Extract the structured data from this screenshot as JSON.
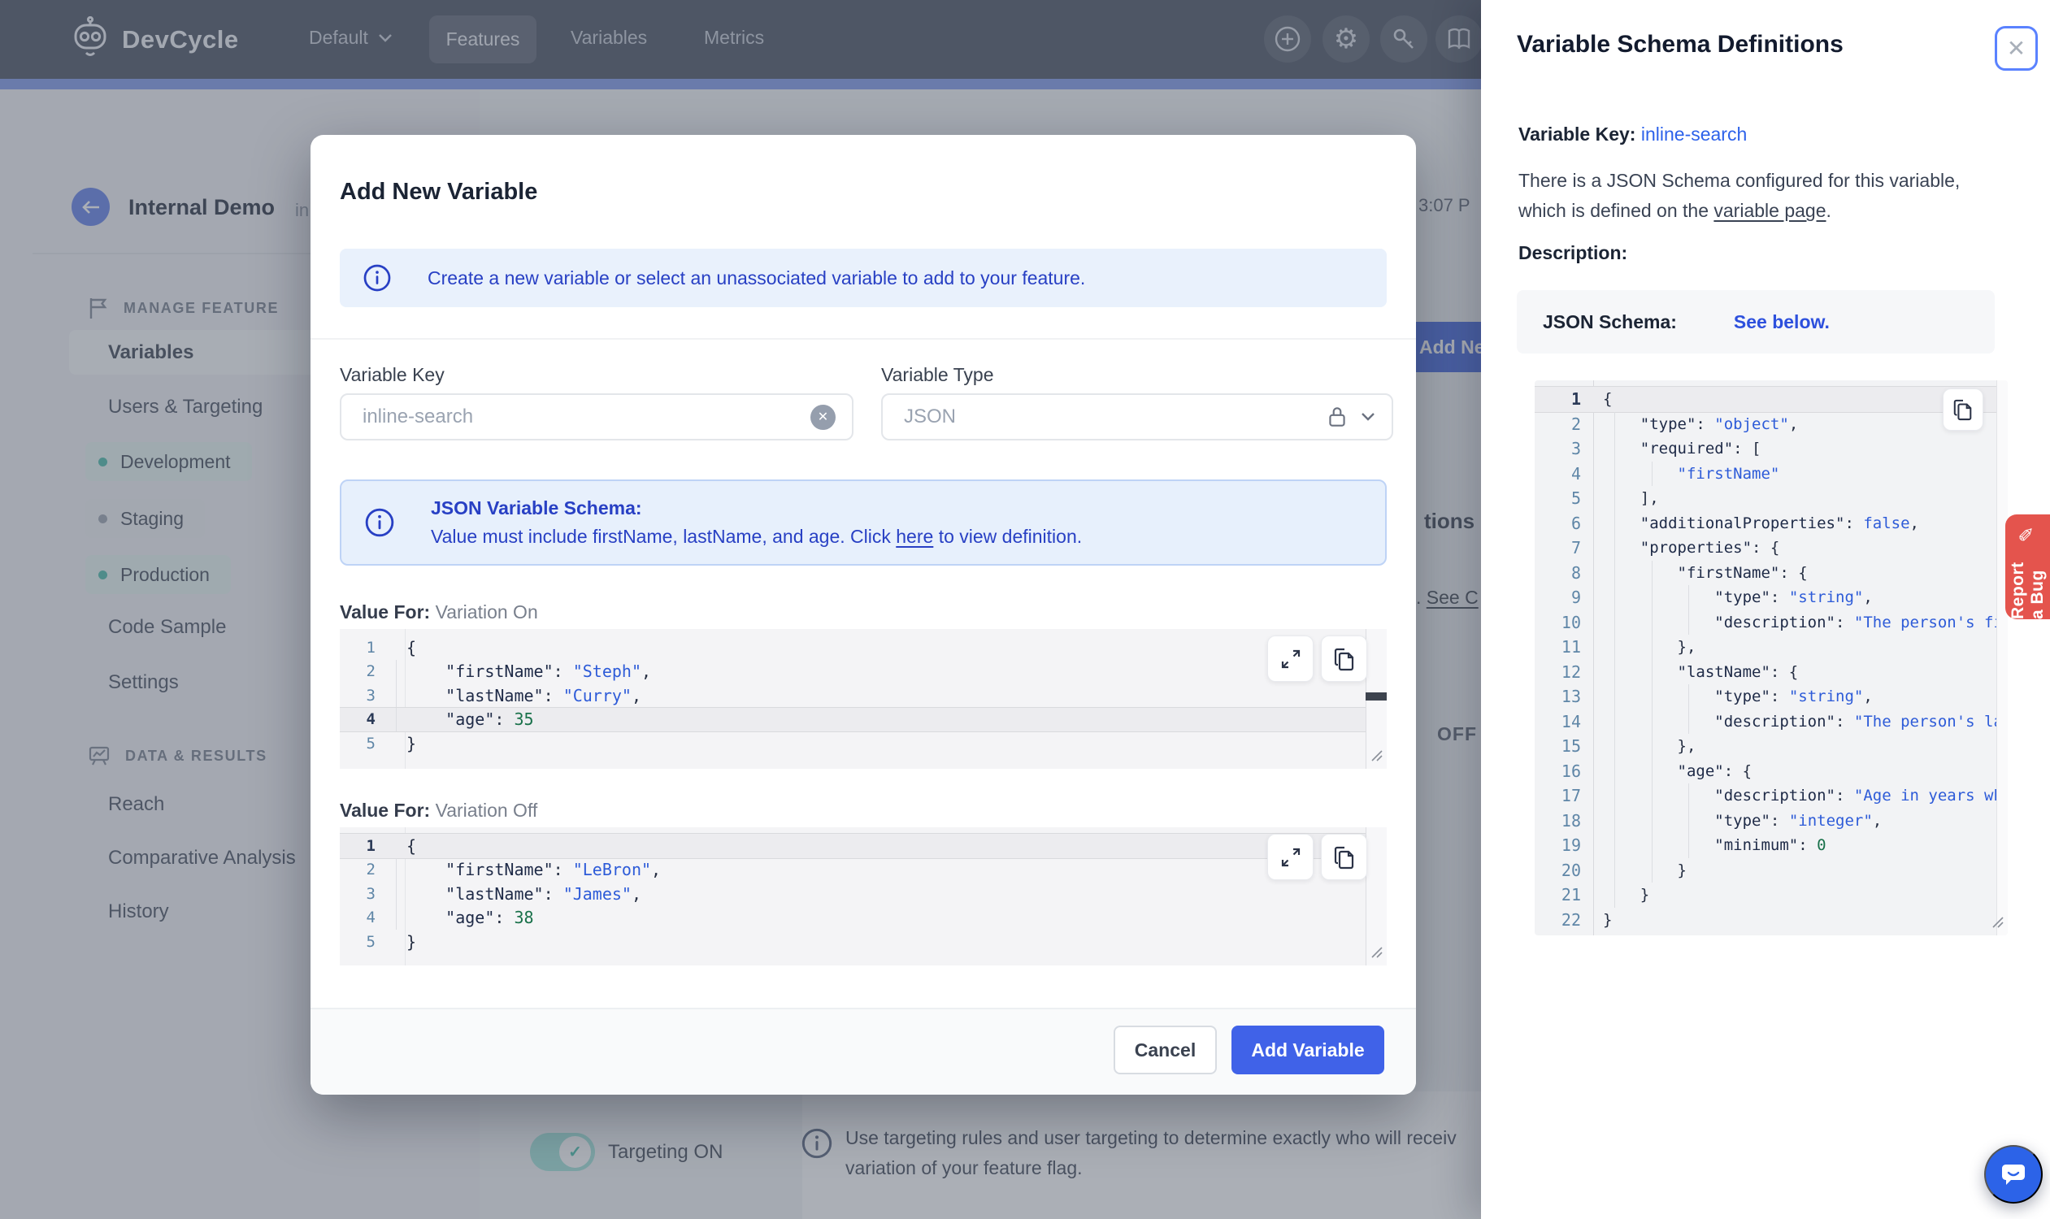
{
  "colors": {
    "accent": "#3e63dd",
    "navbar": "#454c5d",
    "nav_strip": "#7c97e8",
    "info_blue": "#2840c4",
    "link_blue": "#2d62ea",
    "teal": "#43bfa9",
    "bug_red": "#e4544d",
    "code_string": "#2d5bd8",
    "code_number": "#19714a"
  },
  "navbar": {
    "brand": "DevCycle",
    "project": "Default",
    "items": [
      {
        "label": "Features"
      },
      {
        "label": "Variables"
      },
      {
        "label": "Metrics"
      }
    ],
    "icons": [
      "plus-circle",
      "gear",
      "key",
      "book"
    ]
  },
  "sidebar": {
    "title": "Internal Demo",
    "title_fragment": "in",
    "manage_header": "MANAGE FEATURE",
    "items": [
      {
        "label": "Variables"
      },
      {
        "label": "Users & Targeting"
      }
    ],
    "environments": [
      {
        "label": "Development"
      },
      {
        "label": "Staging"
      },
      {
        "label": "Production"
      }
    ],
    "items2": [
      "Code Sample",
      "Settings"
    ],
    "data_header": "DATA & RESULTS",
    "data_items": [
      "Reach",
      "Comparative Analysis",
      "History"
    ]
  },
  "background": {
    "timestamp_fragment": "3:07 P",
    "add_button_fragment": "Add Ne",
    "heading_fragment": "tions an",
    "link_fragment_pre": ". ",
    "link_fragment": "See C",
    "off_label": "OFF",
    "targeting_label": "Targeting ON",
    "toggle_check": "✓",
    "info_line1": "Use targeting rules and user targeting to determine exactly who will receiv",
    "info_line2": "variation of your feature flag."
  },
  "modal": {
    "title": "Add New Variable",
    "banner": "Create a new variable or select an unassociated variable to add to your feature.",
    "variable_key": {
      "label": "Variable Key",
      "value": "inline-search"
    },
    "variable_type": {
      "label": "Variable Type",
      "value": "JSON"
    },
    "schema_notice": {
      "title": "JSON Variable Schema:",
      "text_pre": "Value must include firstName, lastName, and age. Click ",
      "link": "here",
      "text_post": " to view definition."
    },
    "value_on": {
      "label_bold": "Value For:",
      "label": "Variation On"
    },
    "value_off": {
      "label_bold": "Value For:",
      "label": "Variation Off"
    },
    "cancel_label": "Cancel",
    "submit_label": "Add Variable",
    "editor_on_code": [
      {
        "n": 1,
        "g": 0,
        "t": [
          [
            "p",
            "{"
          ]
        ]
      },
      {
        "n": 2,
        "g": 1,
        "t": [
          [
            "p",
            "    "
          ],
          [
            "k",
            "\"firstName\""
          ],
          [
            "p",
            ": "
          ],
          [
            "s",
            "\"Steph\""
          ],
          [
            "p",
            ","
          ]
        ]
      },
      {
        "n": 3,
        "g": 1,
        "t": [
          [
            "p",
            "    "
          ],
          [
            "k",
            "\"lastName\""
          ],
          [
            "p",
            ": "
          ],
          [
            "s",
            "\"Curry\""
          ],
          [
            "p",
            ","
          ]
        ]
      },
      {
        "n": 4,
        "g": 1,
        "a": true,
        "t": [
          [
            "p",
            "    "
          ],
          [
            "k",
            "\"age\""
          ],
          [
            "p",
            ": "
          ],
          [
            "n",
            "35"
          ]
        ]
      },
      {
        "n": 5,
        "g": 0,
        "t": [
          [
            "p",
            "}"
          ]
        ]
      }
    ],
    "editor_off_code": [
      {
        "n": 1,
        "g": 0,
        "a": true,
        "t": [
          [
            "p",
            "{"
          ]
        ]
      },
      {
        "n": 2,
        "g": 1,
        "t": [
          [
            "p",
            "    "
          ],
          [
            "k",
            "\"firstName\""
          ],
          [
            "p",
            ": "
          ],
          [
            "s",
            "\"LeBron\""
          ],
          [
            "p",
            ","
          ]
        ]
      },
      {
        "n": 3,
        "g": 1,
        "t": [
          [
            "p",
            "    "
          ],
          [
            "k",
            "\"lastName\""
          ],
          [
            "p",
            ": "
          ],
          [
            "s",
            "\"James\""
          ],
          [
            "p",
            ","
          ]
        ]
      },
      {
        "n": 4,
        "g": 1,
        "t": [
          [
            "p",
            "    "
          ],
          [
            "k",
            "\"age\""
          ],
          [
            "p",
            ": "
          ],
          [
            "n",
            "38"
          ]
        ]
      },
      {
        "n": 5,
        "g": 0,
        "t": [
          [
            "p",
            "}"
          ]
        ]
      }
    ]
  },
  "panel": {
    "title": "Variable Schema Definitions",
    "close_glyph": "✕",
    "key_label": "Variable Key:",
    "key_value": "inline-search",
    "desc_pre": "There is a JSON Schema configured for this variable, which is defined on the ",
    "desc_link": "variable page",
    "desc_post": ".",
    "description_label": "Description:",
    "schema_label": "JSON Schema:",
    "schema_link": "See below.",
    "schema_code": [
      {
        "n": 1,
        "g": 0,
        "a": true,
        "t": [
          [
            "p",
            "{"
          ]
        ]
      },
      {
        "n": 2,
        "g": 1,
        "t": [
          [
            "p",
            "    "
          ],
          [
            "k",
            "\"type\""
          ],
          [
            "p",
            ": "
          ],
          [
            "s",
            "\"object\""
          ],
          [
            "p",
            ","
          ]
        ]
      },
      {
        "n": 3,
        "g": 1,
        "t": [
          [
            "p",
            "    "
          ],
          [
            "k",
            "\"required\""
          ],
          [
            "p",
            ": ["
          ]
        ]
      },
      {
        "n": 4,
        "g": 2,
        "t": [
          [
            "p",
            "        "
          ],
          [
            "s",
            "\"firstName\""
          ]
        ]
      },
      {
        "n": 5,
        "g": 1,
        "t": [
          [
            "p",
            "    ],"
          ]
        ]
      },
      {
        "n": 6,
        "g": 1,
        "t": [
          [
            "p",
            "    "
          ],
          [
            "k",
            "\"additionalProperties\""
          ],
          [
            "p",
            ": "
          ],
          [
            "b",
            "false"
          ],
          [
            "p",
            ","
          ]
        ]
      },
      {
        "n": 7,
        "g": 1,
        "t": [
          [
            "p",
            "    "
          ],
          [
            "k",
            "\"properties\""
          ],
          [
            "p",
            ": {"
          ]
        ]
      },
      {
        "n": 8,
        "g": 2,
        "t": [
          [
            "p",
            "        "
          ],
          [
            "k",
            "\"firstName\""
          ],
          [
            "p",
            ": {"
          ]
        ]
      },
      {
        "n": 9,
        "g": 3,
        "t": [
          [
            "p",
            "            "
          ],
          [
            "k",
            "\"type\""
          ],
          [
            "p",
            ": "
          ],
          [
            "s",
            "\"string\""
          ],
          [
            "p",
            ","
          ]
        ]
      },
      {
        "n": 10,
        "g": 3,
        "t": [
          [
            "p",
            "            "
          ],
          [
            "k",
            "\"description\""
          ],
          [
            "p",
            ": "
          ],
          [
            "s",
            "\"The person's fi"
          ]
        ]
      },
      {
        "n": 11,
        "g": 2,
        "t": [
          [
            "p",
            "        },"
          ]
        ]
      },
      {
        "n": 12,
        "g": 2,
        "t": [
          [
            "p",
            "        "
          ],
          [
            "k",
            "\"lastName\""
          ],
          [
            "p",
            ": {"
          ]
        ]
      },
      {
        "n": 13,
        "g": 3,
        "t": [
          [
            "p",
            "            "
          ],
          [
            "k",
            "\"type\""
          ],
          [
            "p",
            ": "
          ],
          [
            "s",
            "\"string\""
          ],
          [
            "p",
            ","
          ]
        ]
      },
      {
        "n": 14,
        "g": 3,
        "t": [
          [
            "p",
            "            "
          ],
          [
            "k",
            "\"description\""
          ],
          [
            "p",
            ": "
          ],
          [
            "s",
            "\"The person's la"
          ]
        ]
      },
      {
        "n": 15,
        "g": 2,
        "t": [
          [
            "p",
            "        },"
          ]
        ]
      },
      {
        "n": 16,
        "g": 2,
        "t": [
          [
            "p",
            "        "
          ],
          [
            "k",
            "\"age\""
          ],
          [
            "p",
            ": {"
          ]
        ]
      },
      {
        "n": 17,
        "g": 3,
        "t": [
          [
            "p",
            "            "
          ],
          [
            "k",
            "\"description\""
          ],
          [
            "p",
            ": "
          ],
          [
            "s",
            "\"Age in years wh"
          ]
        ]
      },
      {
        "n": 18,
        "g": 3,
        "t": [
          [
            "p",
            "            "
          ],
          [
            "k",
            "\"type\""
          ],
          [
            "p",
            ": "
          ],
          [
            "s",
            "\"integer\""
          ],
          [
            "p",
            ","
          ]
        ]
      },
      {
        "n": 19,
        "g": 3,
        "t": [
          [
            "p",
            "            "
          ],
          [
            "k",
            "\"minimum\""
          ],
          [
            "p",
            ": "
          ],
          [
            "n",
            "0"
          ]
        ]
      },
      {
        "n": 20,
        "g": 2,
        "t": [
          [
            "p",
            "        }"
          ]
        ]
      },
      {
        "n": 21,
        "g": 1,
        "t": [
          [
            "p",
            "    }"
          ]
        ]
      },
      {
        "n": 22,
        "g": 0,
        "t": [
          [
            "p",
            "}"
          ]
        ]
      }
    ]
  },
  "report_bug_label": "Report a Bug",
  "report_bug_icon": "✎"
}
